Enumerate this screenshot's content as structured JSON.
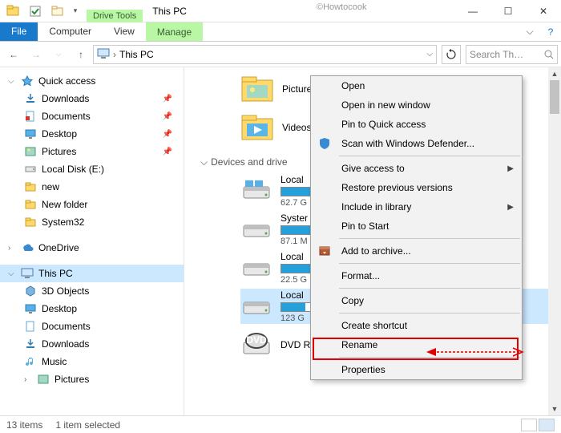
{
  "watermark": "©Howtocook",
  "title": "This PC",
  "drive_tools_top": "Drive Tools",
  "ribbon": {
    "file": "File",
    "computer": "Computer",
    "view": "View",
    "manage": "Manage"
  },
  "address": {
    "location": "This PC",
    "search_placeholder": "Search Th…"
  },
  "nav": {
    "quick": {
      "label": "Quick access",
      "items": [
        {
          "label": "Downloads"
        },
        {
          "label": "Documents"
        },
        {
          "label": "Desktop"
        },
        {
          "label": "Pictures"
        },
        {
          "label": "Local Disk (E:)"
        },
        {
          "label": "new"
        },
        {
          "label": "New folder"
        },
        {
          "label": "System32"
        }
      ]
    },
    "onedrive": "OneDrive",
    "thispc": {
      "label": "This PC",
      "items": [
        {
          "label": "3D Objects"
        },
        {
          "label": "Desktop"
        },
        {
          "label": "Documents"
        },
        {
          "label": "Downloads"
        },
        {
          "label": "Music"
        },
        {
          "label": "Pictures"
        }
      ]
    }
  },
  "content": {
    "folders": [
      {
        "label": "Pictures"
      },
      {
        "label": "Videos"
      }
    ],
    "devices_header": "Devices and drive",
    "drives": [
      {
        "label": "Local",
        "used_pct": 45,
        "sub": "62.7 G"
      },
      {
        "label": "Syster",
        "used_pct": 55,
        "sub": "87.1 M"
      },
      {
        "label": "Local",
        "used_pct": 35,
        "sub": "22.5 G"
      },
      {
        "label": "Local",
        "used_pct": 28,
        "sub": "123 G",
        "selected": true
      },
      {
        "label": "DVD RW Drive (G:)",
        "dvd": true
      }
    ]
  },
  "context_menu": {
    "open": "Open",
    "new_window": "Open in new window",
    "pin_quick": "Pin to Quick access",
    "defender": "Scan with Windows Defender...",
    "give": "Give access to",
    "restore": "Restore previous versions",
    "include": "Include in library",
    "pin_start": "Pin to Start",
    "archive": "Add to archive...",
    "format": "Format...",
    "copy": "Copy",
    "shortcut": "Create shortcut",
    "rename": "Rename",
    "properties": "Properties"
  },
  "status": {
    "count": "13 items",
    "selection": "1 item selected"
  }
}
